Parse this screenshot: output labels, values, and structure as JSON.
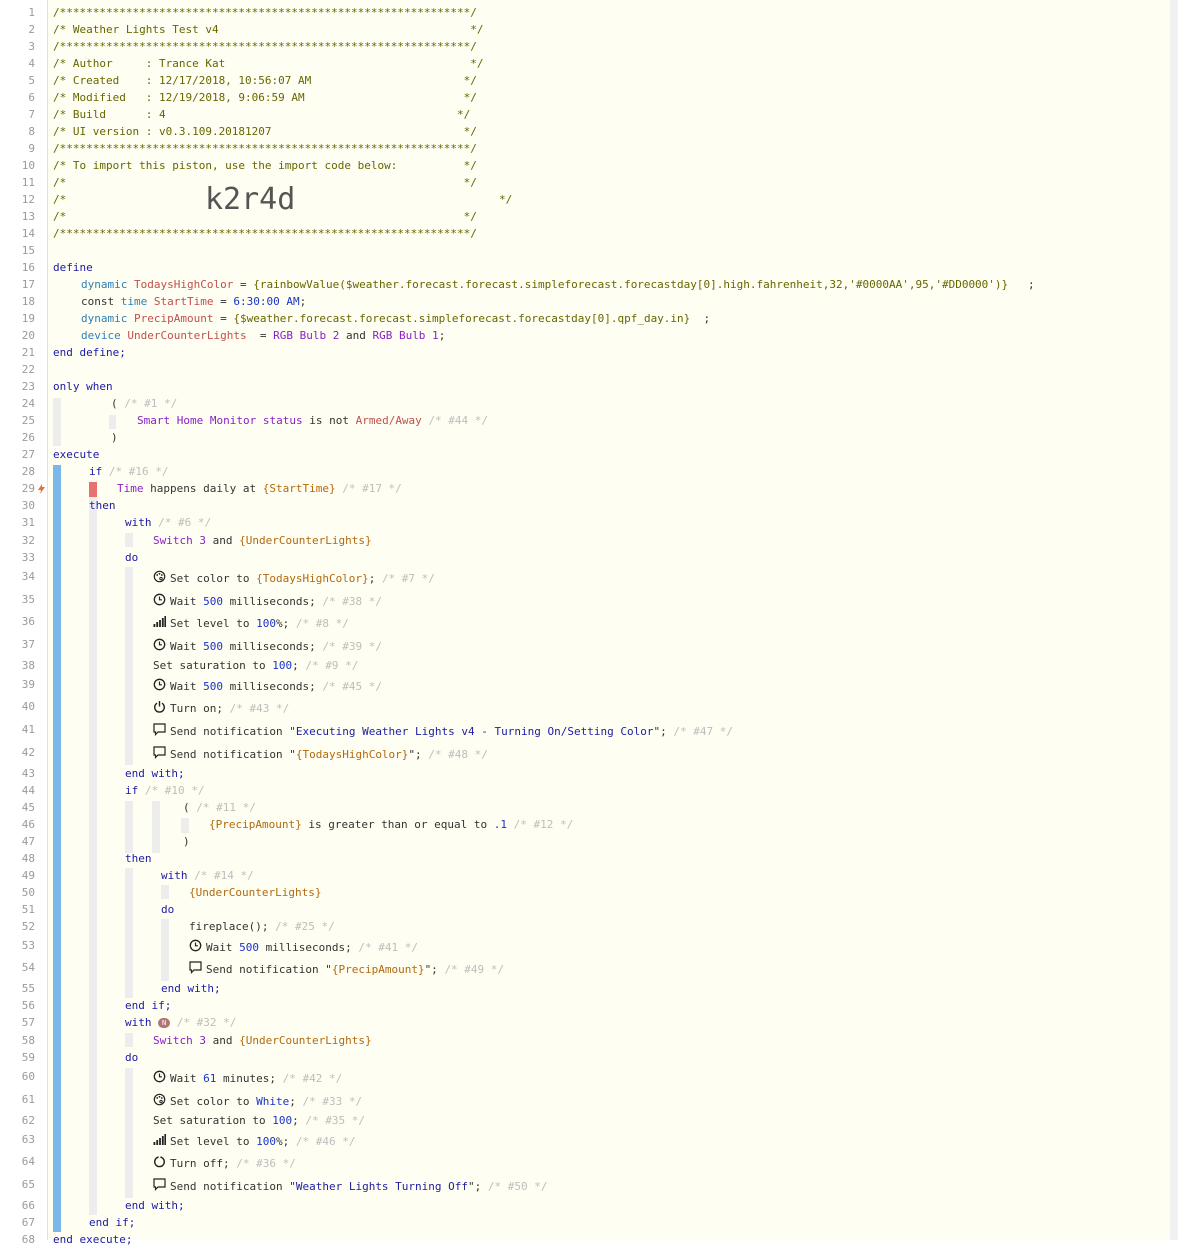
{
  "editor": {
    "line_numbers": [
      "1",
      "2",
      "3",
      "4",
      "5",
      "6",
      "7",
      "8",
      "9",
      "10",
      "11",
      "12",
      "13",
      "14",
      "15",
      "16",
      "17",
      "18",
      "19",
      "20",
      "21",
      "22",
      "23",
      "24",
      "25",
      "26",
      "27",
      "28",
      "29",
      "30",
      "31",
      "32",
      "33",
      "34",
      "35",
      "36",
      "37",
      "38",
      "39",
      "40",
      "41",
      "42",
      "43",
      "44",
      "45",
      "46",
      "47",
      "48",
      "49",
      "50",
      "51",
      "52",
      "53",
      "54",
      "55",
      "56",
      "57",
      "58",
      "59",
      "60",
      "61",
      "62",
      "63",
      "64",
      "65",
      "66",
      "67",
      "68"
    ],
    "header": {
      "stars": "/**************************************************************/",
      "title": "/* Weather Lights Test v4                                      */",
      "author": "/* Author     : Trance Kat                                     */",
      "created": "/* Created    : 12/17/2018, 10:56:07 AM                       */",
      "modified": "/* Modified   : 12/19/2018, 9:06:59 AM                        */",
      "build": "/* Build      : 4                                            */",
      "ui_version": "/* UI version : v0.3.109.20181207                             */",
      "import_line": "/* To import this piston, use the import code below:          */",
      "blank": "/*                                                            */",
      "code_open": "/*",
      "code_close": "*/",
      "import_code": "k2r4d"
    },
    "define": {
      "kw": "define",
      "end": "end define;",
      "l17": {
        "kw": "dynamic",
        "name": "TodaysHighColor",
        "eq": " = ",
        "expr": "{rainbowValue($weather.forecast.forecast.simpleforecast.forecastday[0].high.fahrenheit,32,'#0000AA',95,'#DD0000')}",
        "semi": "   ;"
      },
      "l18": {
        "kw": "const",
        "type": "time",
        "name": "StartTime",
        "eq": " = ",
        "value": "6:30:00 AM",
        "semi": ";"
      },
      "l19": {
        "kw": "dynamic",
        "name": "PrecipAmount",
        "eq": " = ",
        "expr": "{$weather.forecast.forecast.simpleforecast.forecastday[0].qpf_day.in}",
        "semi": "  ;"
      },
      "l20": {
        "kw": "device",
        "name": "UnderCounterLights",
        "eq": "  = ",
        "d1": "RGB Bulb 2",
        "and": " and ",
        "d2": "RGB Bulb 1",
        "semi": ";"
      }
    },
    "only_when": {
      "kw": "only when",
      "open": "(",
      "c1": "/* #1 */",
      "dev": "Smart Home Monitor",
      "attr": "status",
      "is": " is not ",
      "val": "Armed/Away",
      "c44": "/* #44 */",
      "close": ")"
    },
    "execute": {
      "kw": "execute",
      "end": "end execute;",
      "if1": "if",
      "c16": "/* #16 */",
      "l29": {
        "a": "Time",
        "b": " happens daily at ",
        "c": "{StartTime}",
        "cm": "/* #17 */"
      },
      "then": "then",
      "with": "with",
      "do": "do",
      "end_with": "end with;",
      "end_if": "end if;",
      "c6": "/* #6 */",
      "sw": "Switch 3",
      "and": " and ",
      "ucl": "{UnderCounterLights}",
      "l34": {
        "a": "Set color to ",
        "b": "{TodaysHighColor}",
        "c": ";",
        "cm": "/* #7 */"
      },
      "l35": {
        "a": "Wait ",
        "n": "500",
        "b": " milliseconds",
        "c": ";",
        "cm": "/* #38 */"
      },
      "l36": {
        "a": "Set level to ",
        "n": "100",
        "b": "%",
        "c": ";",
        "cm": "/* #8 */"
      },
      "l37": {
        "cm": "/* #39 */"
      },
      "l38": {
        "a": "Set saturation to ",
        "n": "100",
        "c": ";",
        "cm": "/* #9 */"
      },
      "l39": {
        "cm": "/* #45 */"
      },
      "l40": {
        "a": "Turn on",
        "c": ";",
        "cm": "/* #43 */"
      },
      "l41": {
        "a": "Send notification ",
        "q": "\"",
        "b": "Executing Weather Lights v4 - Turning On/Setting Color",
        "c": "\";",
        "cm": "/* #47 */"
      },
      "l42": {
        "a": "Send notification ",
        "q": "\"",
        "b": "{TodaysHighColor}",
        "c": "\";",
        "cm": "/* #48 */"
      },
      "l44": {
        "kw": "if",
        "cm": "/* #10 */"
      },
      "l45": {
        "open": "(",
        "cm": "/* #11 */"
      },
      "l46": {
        "a": "{PrecipAmount}",
        "b": " is greater than or equal to ",
        "n": ".1",
        "cm": "/* #12 */"
      },
      "l47": {
        "close": ")"
      },
      "l49": {
        "cm": "/* #14 */"
      },
      "l52": {
        "a": "fireplace()",
        "c": ";",
        "cm": "/* #25 */"
      },
      "l53": {
        "cm": "/* #41 */"
      },
      "l54": {
        "b": "{PrecipAmount}",
        "cm": "/* #49 */"
      },
      "l57": {
        "badge": "N",
        "cm": "/* #32 */"
      },
      "l60": {
        "n": "61",
        "b": " minutes",
        "cm": "/* #42 */"
      },
      "l61": {
        "a": "Set color to ",
        "b": "White",
        "c": ";",
        "cm": "/* #33 */"
      },
      "l62": {
        "cm": "/* #35 */"
      },
      "l63": {
        "cm": "/* #46 */"
      },
      "l64": {
        "a": "Turn off",
        "c": ";",
        "cm": "/* #36 */"
      },
      "l65": {
        "b": "Weather Lights Turning Off",
        "cm": "/* #50 */"
      }
    }
  },
  "colors": {
    "background": "#fffef2",
    "keyword": "#1a1aa6",
    "variable": "#c0504d",
    "operand": "#b06a10",
    "comment": "#bdbdbd",
    "device": "#8a1fc7",
    "execute_bar": "#7ab8ec",
    "trigger_marker": "#e87070"
  }
}
